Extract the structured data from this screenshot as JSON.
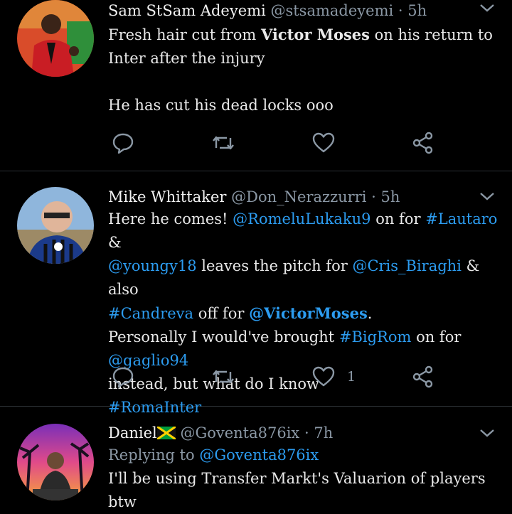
{
  "tweets": [
    {
      "name": "Sam StSam Adeyemi",
      "handle": "@stsamadeyemi",
      "separator": "·",
      "time": "5h",
      "text_pre": "Fresh hair cut from ",
      "text_bold": "Victor Moses",
      "text_post": " on his return to Inter after the injury",
      "text2": "He has cut his dead locks ooo",
      "actions": {
        "reply": "reply-icon",
        "retweet": "retweet-icon",
        "like": "heart-icon",
        "share": "share-icon"
      }
    },
    {
      "name": "Mike Whittaker",
      "handle": "@Don_Nerazzurri",
      "separator": "·",
      "time": "5h",
      "l1a": "Here he comes! ",
      "l1_mention": "@RomeluLukaku9",
      "l1b": " on for ",
      "l1_tag": "#Lautaro",
      "l1c": " &",
      "l2_mention": "@youngy18",
      "l2b": " leaves the pitch for ",
      "l2_mention2": "@Cris_Biraghi",
      "l2c": " & also",
      "l3_tag": "#Candreva",
      "l3b": " off for ",
      "l3_mention": "@VictorMoses",
      "l3c": ".",
      "l4a": "Personally I would've brought ",
      "l4_tag": "#BigRom",
      "l4b": " on for ",
      "l4_mention": "@gaglio94",
      "l5": "instead, but what do I know",
      "l6_tag": "#RomaInter",
      "like_count": "1"
    },
    {
      "name": "Daniel",
      "handle": "@Goventa876ix",
      "separator": "·",
      "time": "7h",
      "reply_prefix": "Replying to ",
      "reply_to": "@Goventa876ix",
      "text": "I'll be using Transfer Markt's Valuarion of players btw"
    }
  ],
  "colors": {
    "background": "#000000",
    "link": "#2c9cf0",
    "muted": "#8b98a5",
    "divider": "#2a2f33"
  }
}
